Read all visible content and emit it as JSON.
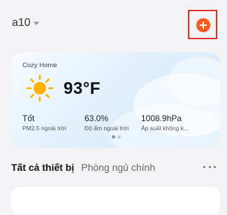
{
  "header": {
    "home_name": "a10",
    "dropdown_icon": "caret-down-icon",
    "add_icon": "plus-circle-icon"
  },
  "weather": {
    "home_label": "Cozy Home",
    "icon": "sun-icon",
    "temperature": "93°F",
    "stats": [
      {
        "value": "Tốt",
        "label": "PM2.5 ngoài trời"
      },
      {
        "value": "63.0%",
        "label": "Độ ẩm ngoài trời"
      },
      {
        "value": "1008.9hPa",
        "label": "Áp suất không k..."
      }
    ],
    "pager": {
      "count": 2,
      "active": 1
    }
  },
  "tabs": {
    "active": "Tất cả thiết bị",
    "inactive": "Phòng ngủ chính",
    "more_icon": "more-horizontal-icon"
  },
  "colors": {
    "accent": "#ff5a1f",
    "highlight_border": "#e02f2f",
    "sun": "#ffb300"
  }
}
